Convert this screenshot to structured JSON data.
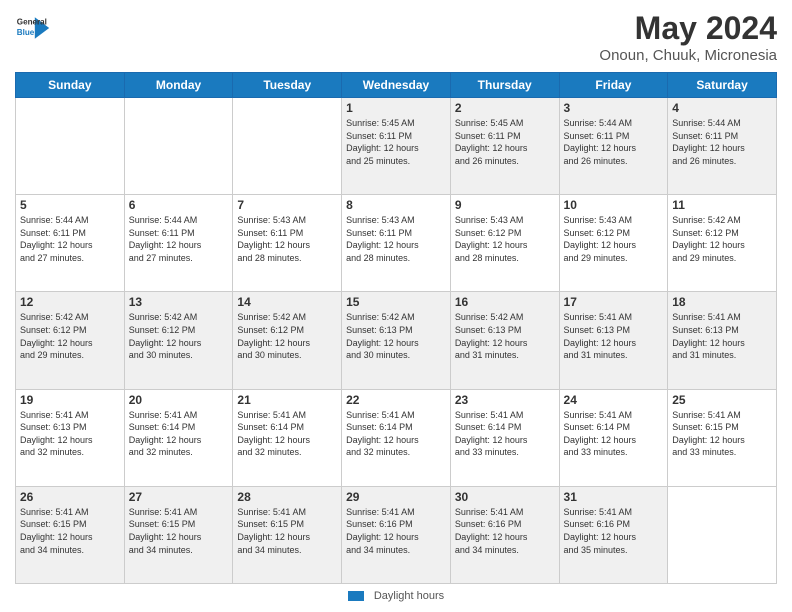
{
  "header": {
    "logo_general": "General",
    "logo_blue": "Blue",
    "main_title": "May 2024",
    "subtitle": "Onoun, Chuuk, Micronesia"
  },
  "calendar": {
    "weekdays": [
      "Sunday",
      "Monday",
      "Tuesday",
      "Wednesday",
      "Thursday",
      "Friday",
      "Saturday"
    ],
    "weeks": [
      [
        {
          "day": "",
          "info": ""
        },
        {
          "day": "",
          "info": ""
        },
        {
          "day": "",
          "info": ""
        },
        {
          "day": "1",
          "info": "Sunrise: 5:45 AM\nSunset: 6:11 PM\nDaylight: 12 hours\nand 25 minutes."
        },
        {
          "day": "2",
          "info": "Sunrise: 5:45 AM\nSunset: 6:11 PM\nDaylight: 12 hours\nand 26 minutes."
        },
        {
          "day": "3",
          "info": "Sunrise: 5:44 AM\nSunset: 6:11 PM\nDaylight: 12 hours\nand 26 minutes."
        },
        {
          "day": "4",
          "info": "Sunrise: 5:44 AM\nSunset: 6:11 PM\nDaylight: 12 hours\nand 26 minutes."
        }
      ],
      [
        {
          "day": "5",
          "info": "Sunrise: 5:44 AM\nSunset: 6:11 PM\nDaylight: 12 hours\nand 27 minutes."
        },
        {
          "day": "6",
          "info": "Sunrise: 5:44 AM\nSunset: 6:11 PM\nDaylight: 12 hours\nand 27 minutes."
        },
        {
          "day": "7",
          "info": "Sunrise: 5:43 AM\nSunset: 6:11 PM\nDaylight: 12 hours\nand 28 minutes."
        },
        {
          "day": "8",
          "info": "Sunrise: 5:43 AM\nSunset: 6:11 PM\nDaylight: 12 hours\nand 28 minutes."
        },
        {
          "day": "9",
          "info": "Sunrise: 5:43 AM\nSunset: 6:12 PM\nDaylight: 12 hours\nand 28 minutes."
        },
        {
          "day": "10",
          "info": "Sunrise: 5:43 AM\nSunset: 6:12 PM\nDaylight: 12 hours\nand 29 minutes."
        },
        {
          "day": "11",
          "info": "Sunrise: 5:42 AM\nSunset: 6:12 PM\nDaylight: 12 hours\nand 29 minutes."
        }
      ],
      [
        {
          "day": "12",
          "info": "Sunrise: 5:42 AM\nSunset: 6:12 PM\nDaylight: 12 hours\nand 29 minutes."
        },
        {
          "day": "13",
          "info": "Sunrise: 5:42 AM\nSunset: 6:12 PM\nDaylight: 12 hours\nand 30 minutes."
        },
        {
          "day": "14",
          "info": "Sunrise: 5:42 AM\nSunset: 6:12 PM\nDaylight: 12 hours\nand 30 minutes."
        },
        {
          "day": "15",
          "info": "Sunrise: 5:42 AM\nSunset: 6:13 PM\nDaylight: 12 hours\nand 30 minutes."
        },
        {
          "day": "16",
          "info": "Sunrise: 5:42 AM\nSunset: 6:13 PM\nDaylight: 12 hours\nand 31 minutes."
        },
        {
          "day": "17",
          "info": "Sunrise: 5:41 AM\nSunset: 6:13 PM\nDaylight: 12 hours\nand 31 minutes."
        },
        {
          "day": "18",
          "info": "Sunrise: 5:41 AM\nSunset: 6:13 PM\nDaylight: 12 hours\nand 31 minutes."
        }
      ],
      [
        {
          "day": "19",
          "info": "Sunrise: 5:41 AM\nSunset: 6:13 PM\nDaylight: 12 hours\nand 32 minutes."
        },
        {
          "day": "20",
          "info": "Sunrise: 5:41 AM\nSunset: 6:14 PM\nDaylight: 12 hours\nand 32 minutes."
        },
        {
          "day": "21",
          "info": "Sunrise: 5:41 AM\nSunset: 6:14 PM\nDaylight: 12 hours\nand 32 minutes."
        },
        {
          "day": "22",
          "info": "Sunrise: 5:41 AM\nSunset: 6:14 PM\nDaylight: 12 hours\nand 32 minutes."
        },
        {
          "day": "23",
          "info": "Sunrise: 5:41 AM\nSunset: 6:14 PM\nDaylight: 12 hours\nand 33 minutes."
        },
        {
          "day": "24",
          "info": "Sunrise: 5:41 AM\nSunset: 6:14 PM\nDaylight: 12 hours\nand 33 minutes."
        },
        {
          "day": "25",
          "info": "Sunrise: 5:41 AM\nSunset: 6:15 PM\nDaylight: 12 hours\nand 33 minutes."
        }
      ],
      [
        {
          "day": "26",
          "info": "Sunrise: 5:41 AM\nSunset: 6:15 PM\nDaylight: 12 hours\nand 34 minutes."
        },
        {
          "day": "27",
          "info": "Sunrise: 5:41 AM\nSunset: 6:15 PM\nDaylight: 12 hours\nand 34 minutes."
        },
        {
          "day": "28",
          "info": "Sunrise: 5:41 AM\nSunset: 6:15 PM\nDaylight: 12 hours\nand 34 minutes."
        },
        {
          "day": "29",
          "info": "Sunrise: 5:41 AM\nSunset: 6:16 PM\nDaylight: 12 hours\nand 34 minutes."
        },
        {
          "day": "30",
          "info": "Sunrise: 5:41 AM\nSunset: 6:16 PM\nDaylight: 12 hours\nand 34 minutes."
        },
        {
          "day": "31",
          "info": "Sunrise: 5:41 AM\nSunset: 6:16 PM\nDaylight: 12 hours\nand 35 minutes."
        },
        {
          "day": "",
          "info": ""
        }
      ]
    ]
  },
  "footer": {
    "legend_label": "Daylight hours"
  }
}
